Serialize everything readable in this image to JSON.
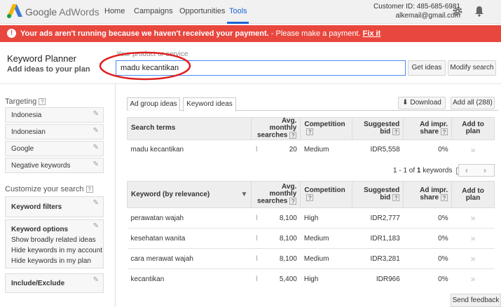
{
  "topbar": {
    "brand": "Google",
    "product": "AdWords",
    "nav": [
      "Home",
      "Campaigns",
      "Opportunities",
      "Tools"
    ],
    "customer_id": "Customer ID: 485-685-6981",
    "email": "alkemail@gmail.com",
    "icons": [
      "gear-icon",
      "bell-icon"
    ]
  },
  "alert": {
    "icon": "!",
    "message_bold": "Your ads aren't running because we haven't received your payment.",
    "message_rest": " - Please make a payment.",
    "link": "Fix it",
    "color": "#e8473e"
  },
  "header": {
    "title": "Keyword Planner",
    "subtitle": "Add ideas to your plan",
    "product_label": "Your product or service",
    "product_value": "madu kecantikan",
    "get_ideas": "Get ideas",
    "modify_search": "Modify search"
  },
  "sidebar": {
    "targeting_title": "Targeting",
    "targeting": [
      "Indonesia",
      "Indonesian",
      "Google",
      "Negative keywords"
    ],
    "customize_title": "Customize your search",
    "keyword_filters": "Keyword filters",
    "keyword_options_title": "Keyword options",
    "keyword_options": [
      "Show broadly related ideas",
      "Hide keywords in my account",
      "Hide keywords in my plan"
    ],
    "include_exclude": "Include/Exclude",
    "help": "?"
  },
  "tabs": [
    "Ad group ideas",
    "Keyword ideas"
  ],
  "actions": {
    "download": "Download",
    "add_all": "Add all (288)"
  },
  "search_terms_table": {
    "headers": [
      "Search terms",
      "Avg. monthly searches",
      "Competition",
      "Suggested bid",
      "Ad impr. share",
      "Add to plan"
    ],
    "rows": [
      {
        "term": "madu kecantikan",
        "searches": "20",
        "competition": "Medium",
        "bid": "IDR5,558",
        "share": "0%"
      }
    ]
  },
  "pager": {
    "text_pre": "1 - 1 of ",
    "total": "1",
    "text_post": " keywords"
  },
  "keyword_table": {
    "headers": [
      "Keyword (by relevance)",
      "Avg. monthly searches",
      "Competition",
      "Suggested bid",
      "Ad impr. share",
      "Add to plan"
    ],
    "rows": [
      {
        "term": "perawatan wajah",
        "searches": "8,100",
        "competition": "High",
        "bid": "IDR2,777",
        "share": "0%"
      },
      {
        "term": "kesehatan wanita",
        "searches": "8,100",
        "competition": "Medium",
        "bid": "IDR1,183",
        "share": "0%"
      },
      {
        "term": "cara merawat wajah",
        "searches": "8,100",
        "competition": "Medium",
        "bid": "IDR3,281",
        "share": "0%"
      },
      {
        "term": "kecantikan",
        "searches": "5,400",
        "competition": "High",
        "bid": "IDR966",
        "share": "0%"
      }
    ]
  },
  "send_feedback": "Send feedback"
}
